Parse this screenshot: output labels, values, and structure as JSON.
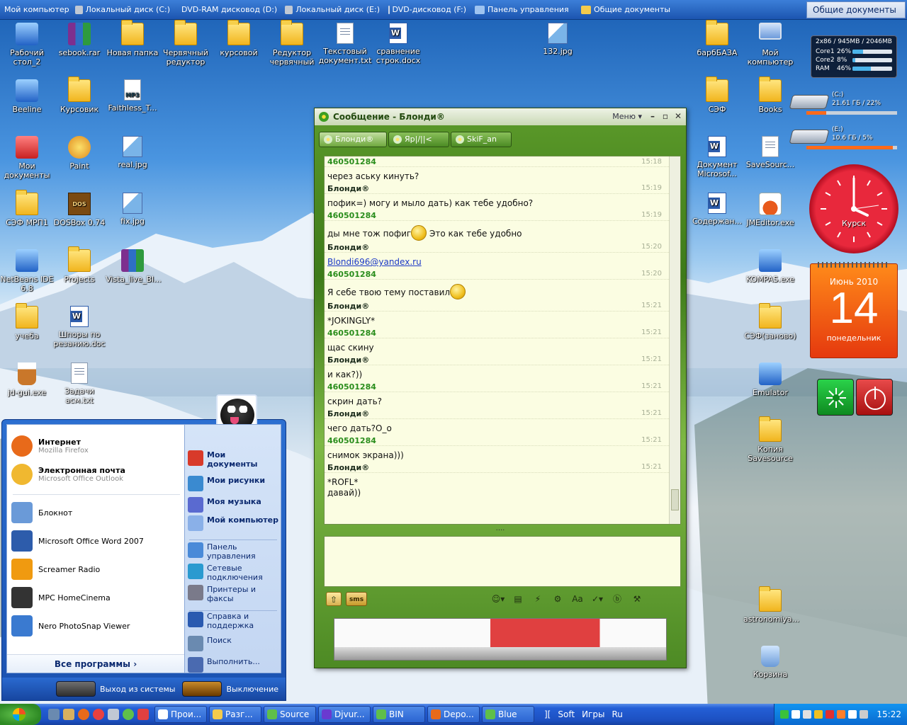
{
  "topbar": {
    "items": [
      {
        "label": "Мой компьютер",
        "color": "#dce8fa"
      },
      {
        "label": "Локальный диск (C:)",
        "color": "#c0c8d4"
      },
      {
        "label": "DVD-RAM дисковод (D:)",
        "color": "#e0e6f0"
      },
      {
        "label": "Локальный диск (E:)",
        "color": "#c0c8d4"
      },
      {
        "label": "DVD-дисковод (F:)",
        "color": "#cdd6e4"
      },
      {
        "label": "Панель управления",
        "color": "#9ec3f0"
      },
      {
        "label": "Общие документы",
        "color": "#f4cb4c"
      }
    ],
    "right_label": "Общие документы"
  },
  "desktop_icons": [
    {
      "label": "Рабочий стол_2",
      "kind": "blue"
    },
    {
      "label": "sebook.rar",
      "kind": "rar"
    },
    {
      "label": "Новая папка",
      "kind": "folder"
    },
    {
      "label": "Червячный редуктор",
      "kind": "folder"
    },
    {
      "label": "курсовой",
      "kind": "folder"
    },
    {
      "label": "Редуктор червячный",
      "kind": "folder"
    },
    {
      "label": "Текстовый документ.txt",
      "kind": "doc"
    },
    {
      "label": "сравнение строк.docx",
      "kind": "word"
    },
    {
      "label": "132.jpg",
      "kind": "img"
    },
    {
      "label": "барбБАЗА",
      "kind": "folder"
    },
    {
      "label": "Мой компьютер",
      "kind": "pc"
    },
    {
      "label": "Beeline",
      "kind": "blue"
    },
    {
      "label": "Курсовик",
      "kind": "folder"
    },
    {
      "label": "Faithless_T...",
      "kind": "mp3"
    },
    {
      "label": "СЭФ",
      "kind": "folder"
    },
    {
      "label": "Books",
      "kind": "folder"
    },
    {
      "label": "Мои документы",
      "kind": "red"
    },
    {
      "label": "Paint",
      "kind": "app"
    },
    {
      "label": "real.jpg",
      "kind": "img"
    },
    {
      "label": "Документ Microsof...",
      "kind": "word"
    },
    {
      "label": "SaveSourc...",
      "kind": "doc"
    },
    {
      "label": "СЭФ МРП1",
      "kind": "folder"
    },
    {
      "label": "DOSBox 0.74",
      "kind": "dos"
    },
    {
      "label": "fix.jpg",
      "kind": "img"
    },
    {
      "label": "Содержан...",
      "kind": "word"
    },
    {
      "label": "JMEditor.exe",
      "kind": "java"
    },
    {
      "label": "NetBeans IDE 6.8",
      "kind": "blue"
    },
    {
      "label": "Projects",
      "kind": "folder"
    },
    {
      "label": "Vista_live_Bl...",
      "kind": "rar"
    },
    {
      "label": "KOMPAS.exe",
      "kind": "blue"
    },
    {
      "label": "учеба",
      "kind": "folder"
    },
    {
      "label": "Шпоры по резанию.doc",
      "kind": "word"
    },
    {
      "label": "СЭФ(заново)",
      "kind": "folder"
    },
    {
      "label": "jd-gui.exe",
      "kind": "cup"
    },
    {
      "label": "Задачи асм.txt",
      "kind": "doc"
    },
    {
      "label": "Emulator",
      "kind": "blue"
    },
    {
      "label": "Копия Savesource",
      "kind": "folder"
    },
    {
      "label": "astronomiya...",
      "kind": "folder"
    },
    {
      "label": "Корзина",
      "kind": "trash"
    }
  ],
  "sysmon": {
    "header": "2x86 / 945MB / 2046MB",
    "rows": [
      {
        "label": "Core1",
        "pct": "26%",
        "fill": 26
      },
      {
        "label": "Core2",
        "pct": "8%",
        "fill": 8
      },
      {
        "label": "RAM",
        "pct": "46%",
        "fill": 46
      }
    ]
  },
  "drives": [
    {
      "name": "(C:)",
      "info": "21.61 ГБ / 22%",
      "fill": 22
    },
    {
      "name": "(E:)",
      "info": "10.6 ГБ / 5%",
      "fill": 95
    }
  ],
  "clock": {
    "label": "Курск"
  },
  "calendar": {
    "month": "Июнь 2010",
    "day": "14",
    "weekday": "понедельник"
  },
  "chat": {
    "title": "Сообщение - Блонди®",
    "menu": "Меню",
    "tabs": [
      "Блонди®",
      "Яр|/||<",
      "SkiF_an"
    ],
    "messages": [
      {
        "sender": "460501284",
        "me": true,
        "time": "15:18",
        "text": "через аську кинуть?"
      },
      {
        "sender": "Блонди®",
        "me": false,
        "time": "15:19",
        "text": "пофик=) могу и мыло дать) как тебе удобно?"
      },
      {
        "sender": "460501284",
        "me": true,
        "time": "15:19",
        "text": "ды мне тож пофиг",
        "after": " Это как тебе удобно",
        "smiley": true
      },
      {
        "sender": "Блонди®",
        "me": false,
        "time": "15:20",
        "link": "Blondi696@yandex.ru"
      },
      {
        "sender": "460501284",
        "me": true,
        "time": "15:20",
        "text": "Я себе твою тему поставил",
        "smiley": true
      },
      {
        "sender": "Блонди®",
        "me": false,
        "time": "15:21",
        "text": "*JOKINGLY*"
      },
      {
        "sender": "460501284",
        "me": true,
        "time": "15:21",
        "text": "щас скину"
      },
      {
        "sender": "Блонди®",
        "me": false,
        "time": "15:21",
        "text": "и как?))"
      },
      {
        "sender": "460501284",
        "me": true,
        "time": "15:21",
        "text": "скрин дать?"
      },
      {
        "sender": "Блонди®",
        "me": false,
        "time": "15:21",
        "text": "чего дать?О_о"
      },
      {
        "sender": "460501284",
        "me": true,
        "time": "15:21",
        "text": "снимок экрана)))"
      },
      {
        "sender": "Блонди®",
        "me": false,
        "time": "15:21",
        "text": "*ROFL*",
        "line2": "давай))"
      }
    ],
    "sms_label": "sms",
    "toolbar_icons": [
      "smiley-icon",
      "note-icon",
      "flash-icon",
      "gear-icon",
      "font-icon",
      "spell-icon",
      "b-icon",
      "settings-icon"
    ]
  },
  "start_menu": {
    "pinned": [
      {
        "title": "Интернет",
        "sub": "Mozilla Firefox",
        "color": "#e86a1a"
      },
      {
        "title": "Электронная почта",
        "sub": "Microsoft Office Outlook",
        "color": "#f0b830"
      }
    ],
    "recent": [
      {
        "title": "Блокнот",
        "color": "#6a9ad8"
      },
      {
        "title": "Microsoft Office Word 2007",
        "color": "#2d5cab"
      },
      {
        "title": "Screamer Radio",
        "color": "#f09a10"
      },
      {
        "title": "MPC HomeCinema",
        "color": "#333"
      },
      {
        "title": "Nero PhotoSnap Viewer",
        "color": "#3a7ad0"
      }
    ],
    "all_programs": "Все программы",
    "right_items": [
      {
        "label": "Мои документы",
        "bold": true,
        "color": "#d83a2a"
      },
      {
        "label": "Мои рисунки",
        "bold": true,
        "color": "#3a8ad0"
      },
      {
        "label": "Моя музыка",
        "bold": true,
        "color": "#5a6ad0"
      },
      {
        "label": "Мой компьютер",
        "bold": true,
        "color": "#8ab0e8"
      },
      {
        "label": "Панель управления",
        "bold": false,
        "color": "#4a8ad8"
      },
      {
        "label": "Сетевые подключения",
        "bold": false,
        "color": "#2a9ad0"
      },
      {
        "label": "Принтеры и факсы",
        "bold": false,
        "color": "#7a7a8a"
      },
      {
        "label": "Справка и поддержка",
        "bold": false,
        "color": "#2a5ab0"
      },
      {
        "label": "Поиск",
        "bold": false,
        "color": "#6a8ab0"
      },
      {
        "label": "Выполнить...",
        "bold": false,
        "color": "#4a6ab0"
      }
    ],
    "logoff": "Выход из системы",
    "shutdown": "Выключение"
  },
  "taskbar": {
    "tasks": [
      {
        "label": "Прои...",
        "color": "#fff"
      },
      {
        "label": "Разг...",
        "color": "#f4cb4c"
      },
      {
        "label": "Source",
        "color": "#5fbf4a"
      },
      {
        "label": "Djvur...",
        "color": "#6a3ad0"
      },
      {
        "label": "BIN",
        "color": "#5fbf4a"
      },
      {
        "label": "Depo...",
        "color": "#e86a1a"
      },
      {
        "label": "Blue",
        "color": "#5fbf4a"
      }
    ],
    "links": [
      "][",
      "Soft",
      "Игры",
      "Ru"
    ],
    "time": "15:22",
    "tray_colors": [
      "#3ac23a",
      "#fff",
      "#e0e0e0",
      "#f0c020",
      "#e03030",
      "#ff7f2a",
      "#fff",
      "#ccc"
    ]
  }
}
